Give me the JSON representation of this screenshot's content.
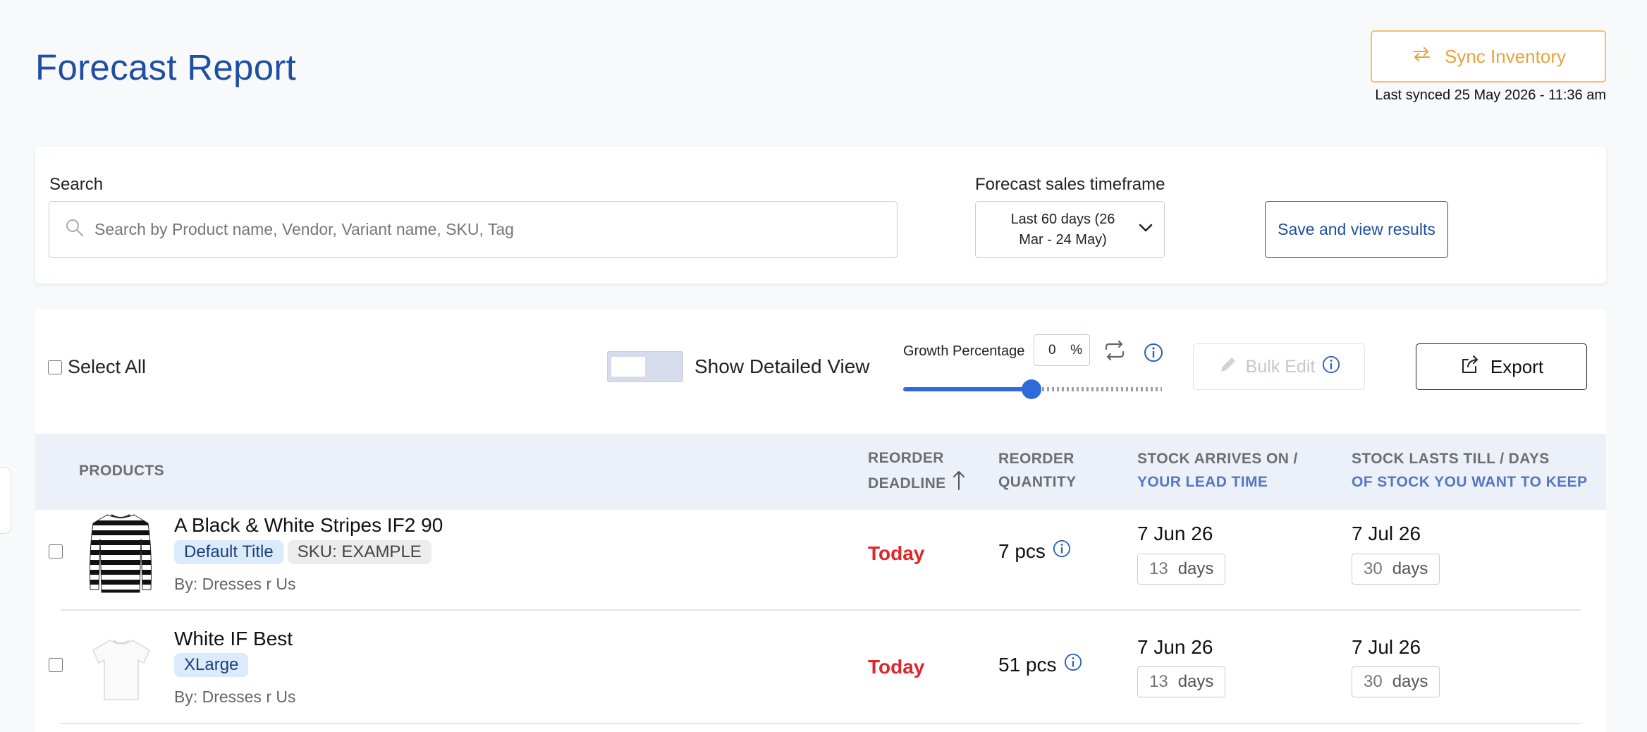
{
  "header": {
    "title": "Forecast Report",
    "sync_label": "Sync Inventory",
    "last_synced": "Last synced 25 May 2026 - 11:36 am"
  },
  "search": {
    "label": "Search",
    "placeholder": "Search by Product name, Vendor, Variant name, SKU, Tag",
    "value": ""
  },
  "forecast": {
    "label": "Forecast sales timeframe",
    "selected_line1": "Last 60 days (26",
    "selected_line2": "Mar - 24 May)"
  },
  "save_label": "Save and view results",
  "toolbar": {
    "select_all": "Select All",
    "show_detailed": "Show Detailed View",
    "growth_label": "Growth Percentage",
    "growth_value": "0",
    "growth_unit": "%",
    "growth_slider_fraction": 0.5,
    "bulk_edit": "Bulk Edit",
    "export": "Export"
  },
  "table": {
    "columns": {
      "products": "PRODUCTS",
      "deadline_1": "REORDER",
      "deadline_2": "DEADLINE",
      "quantity_1": "REORDER",
      "quantity_2": "QUANTITY",
      "arrives_1": "STOCK ARRIVES ON /",
      "arrives_2": "YOUR LEAD TIME",
      "lasts_1": "STOCK LASTS TILL / DAYS",
      "lasts_2": "OF STOCK YOU WANT TO KEEP"
    },
    "rows": [
      {
        "name": "A Black & White Stripes IF2 90",
        "variant": "Default Title",
        "sku": "SKU: EXAMPLE",
        "vendor": "By: Dresses r Us",
        "deadline": "Today",
        "quantity": "7 pcs",
        "arrives_date": "7 Jun 26",
        "lead_days": "13",
        "days_unit": "days",
        "lasts_date": "7 Jul 26",
        "keep_days": "30"
      },
      {
        "name": "White IF Best",
        "variant": "XLarge",
        "vendor": "By: Dresses r Us",
        "deadline": "Today",
        "quantity": "51 pcs",
        "arrives_date": "7 Jun 26",
        "lead_days": "13",
        "days_unit": "days",
        "lasts_date": "7 Jul 26",
        "keep_days": "30"
      }
    ]
  },
  "colors": {
    "title": "#1f4ea3",
    "sync_accent": "#e8a23a",
    "deadline_red": "#e0252b",
    "slider_blue": "#2e6ad8",
    "header_bg": "#ecf0f8"
  }
}
